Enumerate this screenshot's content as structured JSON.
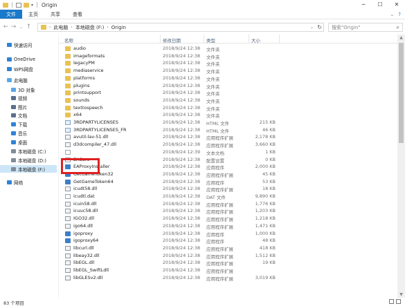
{
  "window": {
    "title": "Origin"
  },
  "ribbon": {
    "tabs": [
      "文件",
      "主页",
      "共享",
      "查看"
    ]
  },
  "address": {
    "crumbs": [
      "此电脑",
      "本地磁盘 (F:)",
      "Origin"
    ],
    "search_placeholder": "搜索\"Origin\""
  },
  "nav": {
    "items": [
      {
        "label": "快速访问",
        "icon": "star-icon",
        "color": "#2f83d6"
      },
      {
        "label": "OneDrive",
        "icon": "cloud-icon",
        "color": "#2f83d6"
      },
      {
        "label": "WPS网盘",
        "icon": "cloud-icon",
        "color": "#2f83d6"
      },
      {
        "label": "此电脑",
        "icon": "computer-icon",
        "color": "#5aa7e6"
      },
      {
        "label": "3D 对象",
        "icon": "cube-icon",
        "color": "#5aa7e6"
      },
      {
        "label": "视频",
        "icon": "video-icon",
        "color": "#5a6f8a"
      },
      {
        "label": "图片",
        "icon": "picture-icon",
        "color": "#5a6f8a"
      },
      {
        "label": "文档",
        "icon": "document-icon",
        "color": "#5a6f8a"
      },
      {
        "label": "下载",
        "icon": "download-icon",
        "color": "#2f83d6"
      },
      {
        "label": "音乐",
        "icon": "music-icon",
        "color": "#2f83d6"
      },
      {
        "label": "桌面",
        "icon": "desktop-icon",
        "color": "#2f83d6"
      },
      {
        "label": "本地磁盘 (C:)",
        "icon": "drive-icon",
        "color": "#7f8c99"
      },
      {
        "label": "本地磁盘 (D:)",
        "icon": "drive-icon",
        "color": "#7f8c99"
      },
      {
        "label": "本地磁盘 (F:)",
        "icon": "drive-icon",
        "color": "#7f8c99"
      },
      {
        "label": "网络",
        "icon": "network-icon",
        "color": "#2f83d6"
      }
    ]
  },
  "columns": {
    "name": "名称",
    "date": "修改日期",
    "type": "类型",
    "size": "大小"
  },
  "files": [
    {
      "name": "audio",
      "date": "2018/9/24 12:38",
      "type": "文件夹",
      "size": "",
      "kind": "folder"
    },
    {
      "name": "imageformats",
      "date": "2018/9/24 12:38",
      "type": "文件夹",
      "size": "",
      "kind": "folder"
    },
    {
      "name": "legacyPM",
      "date": "2018/9/24 12:38",
      "type": "文件夹",
      "size": "",
      "kind": "folder"
    },
    {
      "name": "mediaservice",
      "date": "2018/9/24 12:38",
      "type": "文件夹",
      "size": "",
      "kind": "folder"
    },
    {
      "name": "platforms",
      "date": "2018/9/24 12:38",
      "type": "文件夹",
      "size": "",
      "kind": "folder"
    },
    {
      "name": "plugins",
      "date": "2018/9/24 12:38",
      "type": "文件夹",
      "size": "",
      "kind": "folder"
    },
    {
      "name": "printsupport",
      "date": "2018/9/24 12:38",
      "type": "文件夹",
      "size": "",
      "kind": "folder"
    },
    {
      "name": "sounds",
      "date": "2018/9/24 12:38",
      "type": "文件夹",
      "size": "",
      "kind": "folder"
    },
    {
      "name": "texttospeech",
      "date": "2018/9/24 12:38",
      "type": "文件夹",
      "size": "",
      "kind": "folder"
    },
    {
      "name": "x64",
      "date": "2018/9/24 12:38",
      "type": "文件夹",
      "size": "",
      "kind": "folder"
    },
    {
      "name": "3RDPARTYLICENSES",
      "date": "2018/9/24 12:38",
      "type": "HTML 文件",
      "size": "215 KB",
      "kind": "html"
    },
    {
      "name": "3RDPARTYLICENSES_FR",
      "date": "2018/9/24 12:38",
      "type": "HTML 文件",
      "size": "46 KB",
      "kind": "html"
    },
    {
      "name": "avutil-lav-51.dll",
      "date": "2018/9/24 12:38",
      "type": "应用程序扩展",
      "size": "2,178 KB",
      "kind": "dll"
    },
    {
      "name": "d3dcompiler_47.dll",
      "date": "2018/9/24 12:38",
      "type": "应用程序扩展",
      "size": "3,660 KB",
      "kind": "dll"
    },
    {
      "name": "",
      "date": "2018/9/24 12:39",
      "type": "文本文档",
      "size": "1 KB",
      "kind": "file"
    },
    {
      "name": "EACore",
      "date": "2018/9/24 12:38",
      "type": "配置设置",
      "size": "0 KB",
      "kind": "file"
    },
    {
      "name": "EAProxyInstaller",
      "date": "2018/9/24 12:38",
      "type": "应用程序",
      "size": "2,000 KB",
      "kind": "exe"
    },
    {
      "name": "GetGameToken32",
      "date": "2018/9/24 12:38",
      "type": "应用程序扩展",
      "size": "45 KB",
      "kind": "exe"
    },
    {
      "name": "GetGameToken64",
      "date": "2018/9/24 12:38",
      "type": "应用程序",
      "size": "53 KB",
      "kind": "exe"
    },
    {
      "name": "icudt58.dll",
      "date": "2018/9/24 12:38",
      "type": "应用程序扩展",
      "size": "18 KB",
      "kind": "dll"
    },
    {
      "name": "icudtl.dat",
      "date": "2018/9/24 12:38",
      "type": "DAT 文件",
      "size": "9,890 KB",
      "kind": "file"
    },
    {
      "name": "icuin58.dll",
      "date": "2018/9/24 12:38",
      "type": "应用程序扩展",
      "size": "1,776 KB",
      "kind": "dll"
    },
    {
      "name": "icuuc58.dll",
      "date": "2018/9/24 12:38",
      "type": "应用程序扩展",
      "size": "1,203 KB",
      "kind": "dll"
    },
    {
      "name": "IGO32.dll",
      "date": "2018/9/24 12:38",
      "type": "应用程序扩展",
      "size": "1,218 KB",
      "kind": "dll"
    },
    {
      "name": "igo64.dll",
      "date": "2018/9/24 12:38",
      "type": "应用程序扩展",
      "size": "1,471 KB",
      "kind": "dll"
    },
    {
      "name": "igoproxy",
      "date": "2018/9/24 12:38",
      "type": "应用程序",
      "size": "1,000 KB",
      "kind": "exe"
    },
    {
      "name": "igoproxy64",
      "date": "2018/9/24 12:38",
      "type": "应用程序",
      "size": "48 KB",
      "kind": "exe"
    },
    {
      "name": "libcurl.dll",
      "date": "2018/9/24 12:38",
      "type": "应用程序扩展",
      "size": "418 KB",
      "kind": "dll"
    },
    {
      "name": "libeay32.dll",
      "date": "2018/9/24 12:38",
      "type": "应用程序扩展",
      "size": "1,512 KB",
      "kind": "dll"
    },
    {
      "name": "libEGL.dll",
      "date": "2018/9/24 12:38",
      "type": "应用程序扩展",
      "size": "19 KB",
      "kind": "dll"
    },
    {
      "name": "libEGL_SwiftLdll",
      "date": "2018/9/24 12:38",
      "type": "应用程序扩展",
      "size": "",
      "kind": "dll"
    },
    {
      "name": "libGLESv2.dll",
      "date": "2018/9/24 12:38",
      "type": "应用程序扩展",
      "size": "3,019 KB",
      "kind": "dll"
    }
  ],
  "status": {
    "count": "83 个项目"
  }
}
